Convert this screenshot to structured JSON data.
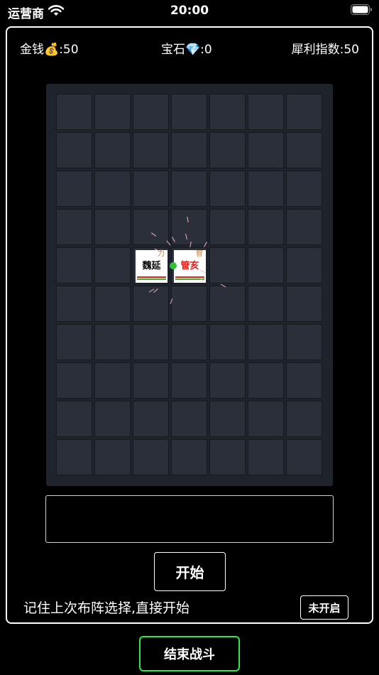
{
  "status_bar": {
    "carrier": "运营商",
    "time": "20:00"
  },
  "stats": {
    "gold_label": "金钱",
    "gold_icon": "money-bag",
    "gold_value": ":50",
    "gem_label": "宝石",
    "gem_icon": "gem",
    "gem_value": ":0",
    "index_label": "犀利指数:50"
  },
  "board": {
    "columns": 7,
    "rows": 10,
    "units": [
      {
        "name": "魏延",
        "attribute": "力",
        "name_color": "#000000",
        "row": 5,
        "col": 3
      },
      {
        "name": "管亥",
        "attribute": "智",
        "name_color": "#e0201b",
        "row": 5,
        "col": 4
      }
    ]
  },
  "message_box": "",
  "buttons": {
    "start": "开始",
    "toggle": "未开启",
    "end_battle": "结束战斗"
  },
  "remember_text": "记住上次布阵选择,直接开始",
  "colors": {
    "end_button_border": "#2ee84a",
    "link_dot": "#2fbf3a",
    "board_bg": "#1f232b",
    "cell_bg": "#2a2f39"
  }
}
